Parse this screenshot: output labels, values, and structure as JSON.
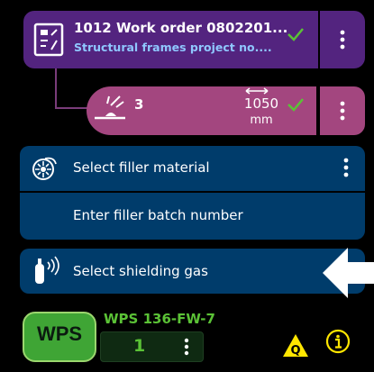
{
  "work_order": {
    "title": "1012 Work order 0802201...",
    "subtitle": "Structural frames project no...."
  },
  "weld": {
    "count": "3",
    "value": "1050",
    "unit": "mm"
  },
  "filler": {
    "select_label": "Select filler material",
    "batch_label": "Enter filler batch number"
  },
  "gas": {
    "select_label": "Select shielding gas"
  },
  "wps": {
    "badge": "WPS",
    "name": "WPS 136-FW-7",
    "count": "1"
  },
  "quality_badge": "Q",
  "colors": {
    "work_order_bg": "#53247f",
    "weld_bg": "#a3467f",
    "panel_bg": "#003c6b",
    "check": "#5bc236",
    "wps_green": "#3fa535",
    "subtitle_blue": "#8fc7ff",
    "warning_yellow": "#ffe600"
  },
  "icons": [
    "work-order-icon",
    "checkmark-icon",
    "more-vert-icon",
    "weld-icon",
    "length-arrow-icon",
    "filler-reel-icon",
    "gas-bottle-icon",
    "arrow-left-icon",
    "quality-warning-icon",
    "info-icon"
  ]
}
